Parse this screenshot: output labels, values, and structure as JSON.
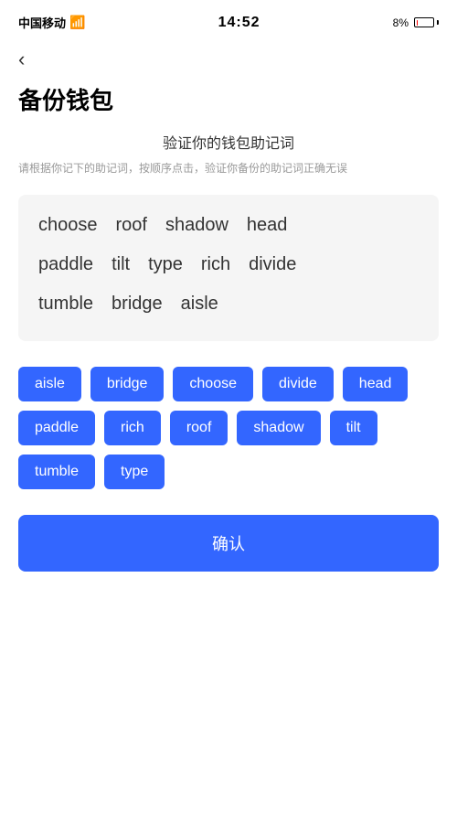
{
  "statusBar": {
    "carrier": "中国移动",
    "time": "14:52",
    "batteryPercent": "8%"
  },
  "backButton": {
    "arrowSymbol": "‹"
  },
  "pageTitle": "备份钱包",
  "sectionHeader": {
    "title": "验证你的钱包助记词",
    "description": "请根据你记下的助记词，按顺序点击，验证你备份的助记词正确无误"
  },
  "displayWords": {
    "row1": [
      "choose",
      "roof",
      "shadow",
      "head"
    ],
    "row2": [
      "paddle",
      "tilt",
      "type",
      "rich",
      "divide"
    ],
    "row3": [
      "tumble",
      "bridge",
      "aisle"
    ]
  },
  "wordChips": [
    "aisle",
    "bridge",
    "choose",
    "divide",
    "head",
    "paddle",
    "rich",
    "roof",
    "shadow",
    "tilt",
    "tumble",
    "type"
  ],
  "confirmButton": {
    "label": "确认"
  }
}
